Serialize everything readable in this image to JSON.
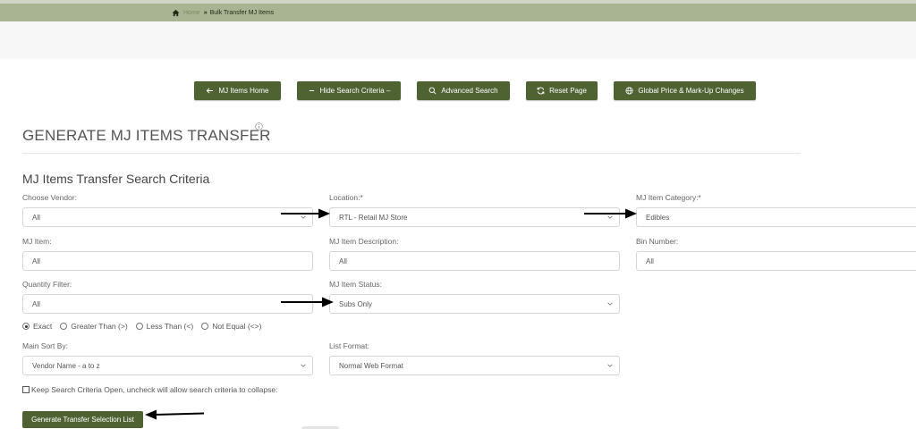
{
  "breadcrumb": {
    "home": "Home",
    "current": "Bulk Transfer MJ Items"
  },
  "toolbar": {
    "mj_items_home": "MJ Items Home",
    "hide_search_criteria": "Hide Search Criteria –",
    "advanced_search": "Advanced Search",
    "reset_page": "Reset Page",
    "global_price": "Global Price & Mark-Up Changes"
  },
  "page": {
    "title": "GENERATE MJ ITEMS TRANSFER",
    "section_title": "MJ Items Transfer Search Criteria"
  },
  "form": {
    "vendor": {
      "label": "Choose Vendor:",
      "value": "All"
    },
    "location": {
      "label": "Location:*",
      "value": "RTL - Retail MJ Store"
    },
    "category": {
      "label": "MJ Item Category:*",
      "value": "Edibles"
    },
    "item": {
      "label": "MJ Item:",
      "value": "All"
    },
    "description": {
      "label": "MJ Item Description:",
      "value": "All"
    },
    "bin": {
      "label": "Bin Number:",
      "value": "All"
    },
    "quantity": {
      "label": "Quantity Filter:",
      "value": "All"
    },
    "status": {
      "label": "MJ Item Status:",
      "value": "Subs Only"
    },
    "qty_options": [
      "Exact",
      "Greater Than (>)",
      "Less Than (<)",
      "Not Equal (<>)"
    ],
    "sort": {
      "label": "Main Sort By:",
      "value": "Vendor Name - a to z"
    },
    "format": {
      "label": "List Format:",
      "value": "Normal Web Format"
    },
    "keep_open": "Keep Search Criteria Open, uncheck will allow search criteria to collapse:",
    "generate": "Generate Transfer Selection List"
  },
  "colors": {
    "accent": "#4f6232",
    "breadcrumb_bar": "#a9b492"
  }
}
